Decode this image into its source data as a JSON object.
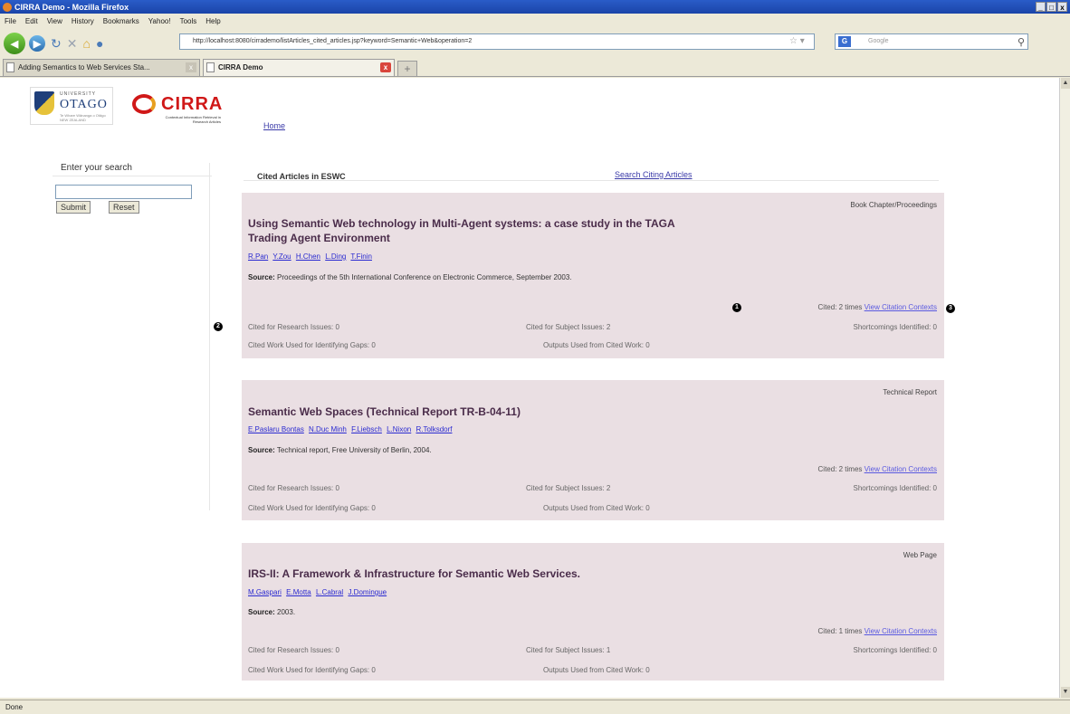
{
  "window": {
    "title": "CIRRA Demo - Mozilla Firefox",
    "controls": [
      "_",
      "□",
      "x"
    ]
  },
  "menu": [
    "File",
    "Edit",
    "View",
    "History",
    "Bookmarks",
    "Yahoo!",
    "Tools",
    "Help"
  ],
  "nav": {
    "url": "http://localhost:8080/cirrademo/listArticles_cited_articles.jsp?keyword=Semantic+Web&operation=2",
    "search_placeholder": "Google"
  },
  "tabs": [
    {
      "label": "Adding Semantics to Web Services Sta...",
      "active": false
    },
    {
      "label": "CIRRA Demo",
      "active": true
    }
  ],
  "page": {
    "home_link": "Home",
    "logos": {
      "university_small": "UNIVERSITY",
      "university_name": "OTAGO",
      "university_sub": "Te Whare Wānanga o Otāgo  NEW ZEALAND",
      "cirra_name": "CIRRA",
      "cirra_sub": "Contextual Information Retrieval in Research Articles"
    },
    "sidebar": {
      "search_label": "Enter your search",
      "search_value": "",
      "submit_label": "Submit",
      "reset_label": "Reset"
    },
    "header": {
      "cited_title": "Cited Articles in ESWC",
      "search_citing_link": "Search Citing Articles"
    },
    "articles": [
      {
        "type": "Book Chapter/Proceedings",
        "title": "Using Semantic Web technology in Multi-Agent systems: a case study in the TAGA Trading Agent Environment",
        "authors": [
          "R.Pan",
          "Y.Zou",
          "H.Chen",
          "L.Ding",
          "T.Finin"
        ],
        "source_label": "Source:",
        "source": "Proceedings of the 5th International Conference on Electronic Commerce, September 2003.",
        "cited_text": "Cited: 2 times",
        "view_link": "View Citation Contexts",
        "research_issues": "Cited for Research Issues: 0",
        "subject_issues": "Cited for Subject Issues: 2",
        "shortcomings": "Shortcomings Identified: 0",
        "gaps": "Cited Work Used for Identifying Gaps: 0",
        "outputs": "Outputs Used from Cited Work: 0"
      },
      {
        "type": "Technical Report",
        "title": "Semantic Web Spaces (Technical Report TR-B-04-11)",
        "authors": [
          "E.Paslaru Bontas",
          "N.Duc Minh",
          "F.Liebsch",
          "L.Nixon",
          "R.Tolksdorf"
        ],
        "source_label": "Source:",
        "source": "Technical report, Free University of Berlin, 2004.",
        "cited_text": "Cited: 2 times",
        "view_link": "View Citation Contexts",
        "research_issues": "Cited for Research Issues: 0",
        "subject_issues": "Cited for Subject Issues: 2",
        "shortcomings": "Shortcomings Identified: 0",
        "gaps": "Cited Work Used for Identifying Gaps: 0",
        "outputs": "Outputs Used from Cited Work: 0"
      },
      {
        "type": "Web Page",
        "title": "IRS-II: A Framework & Infrastructure for Semantic Web Services.",
        "authors": [
          "M.Gaspari",
          "E.Motta",
          "L.Cabral",
          "J.Domingue"
        ],
        "source_label": "Source:",
        "source": "2003.",
        "cited_text": "Cited: 1 times",
        "view_link": "View Citation Contexts",
        "research_issues": "Cited for Research Issues: 0",
        "subject_issues": "Cited for Subject Issues: 1",
        "shortcomings": "Shortcomings Identified: 0",
        "gaps": "Cited Work Used for Identifying Gaps: 0",
        "outputs": "Outputs Used from Cited Work: 0"
      }
    ],
    "markers": [
      "1",
      "2",
      "3"
    ]
  },
  "status": "Done"
}
